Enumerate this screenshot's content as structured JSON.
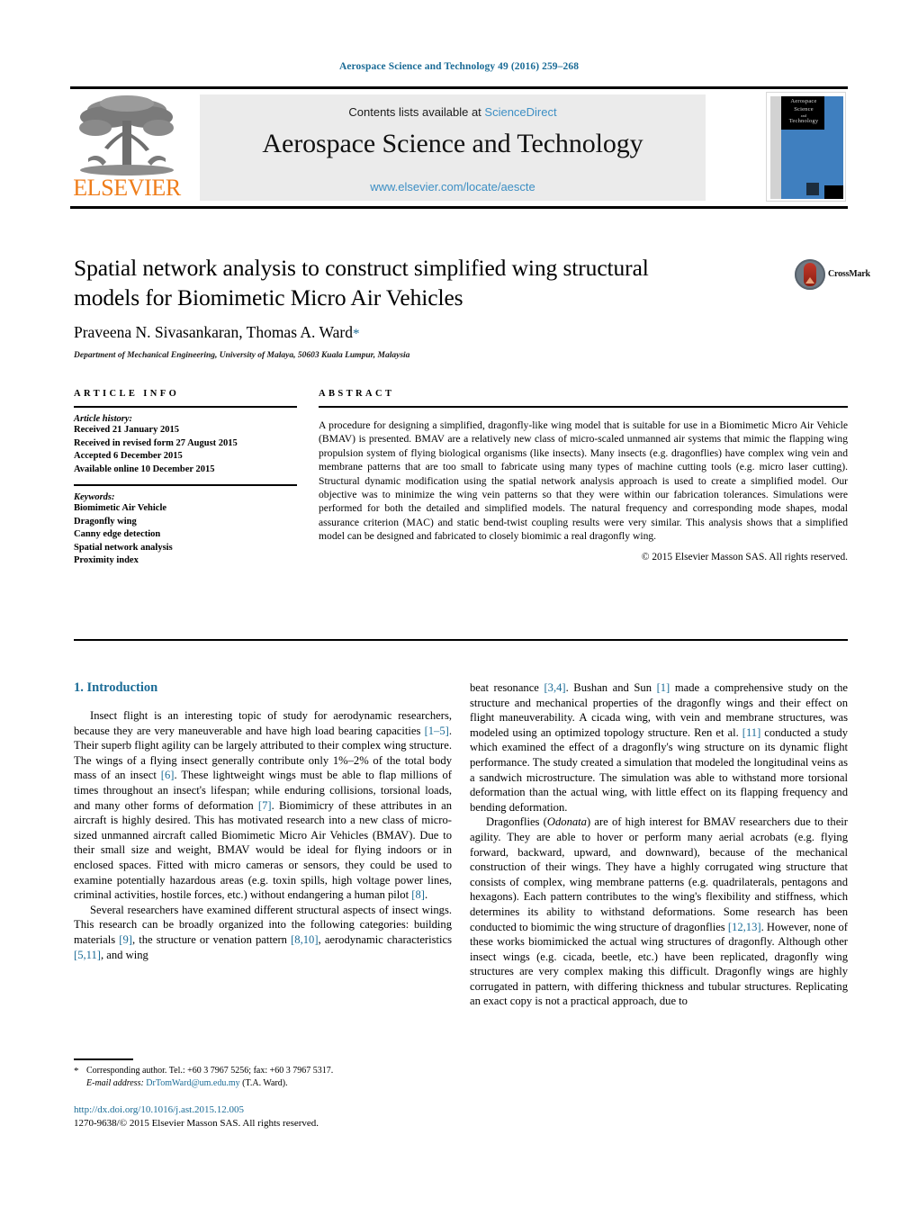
{
  "running_head": "Aerospace Science and Technology 49 (2016) 259–268",
  "masthead": {
    "contents_prefix": "Contents lists available at ",
    "sciencedirect": "ScienceDirect",
    "journal_name": "Aerospace Science and Technology",
    "url": "www.elsevier.com/locate/aescte",
    "publisher": "ELSEVIER",
    "cover_line1": "Aerospace",
    "cover_line2": "Science",
    "cover_line3": "and",
    "cover_line4": "Technology"
  },
  "article": {
    "title": "Spatial network analysis to construct simplified wing structural models for Biomimetic Micro Air Vehicles",
    "authors": "Praveena N. Sivasankaran, Thomas A. Ward",
    "corresponding_marker": "*",
    "affiliation": "Department of Mechanical Engineering, University of Malaya, 50603 Kuala Lumpur, Malaysia",
    "crossmark_label": "CrossMark"
  },
  "article_info": {
    "heading": "ARTICLE INFO",
    "history_label": "Article history:",
    "history": [
      "Received 21 January 2015",
      "Received in revised form 27 August 2015",
      "Accepted 6 December 2015",
      "Available online 10 December 2015"
    ],
    "keywords_label": "Keywords:",
    "keywords": [
      "Biomimetic Air Vehicle",
      "Dragonfly wing",
      "Canny edge detection",
      "Spatial network analysis",
      "Proximity index"
    ]
  },
  "abstract": {
    "heading": "ABSTRACT",
    "text": "A procedure for designing a simplified, dragonfly-like wing model that is suitable for use in a Biomimetic Micro Air Vehicle (BMAV) is presented. BMAV are a relatively new class of micro-scaled unmanned air systems that mimic the flapping wing propulsion system of flying biological organisms (like insects). Many insects (e.g. dragonflies) have complex wing vein and membrane patterns that are too small to fabricate using many types of machine cutting tools (e.g. micro laser cutting). Structural dynamic modification using the spatial network analysis approach is used to create a simplified model. Our objective was to minimize the wing vein patterns so that they were within our fabrication tolerances. Simulations were performed for both the detailed and simplified models. The natural frequency and corresponding mode shapes, modal assurance criterion (MAC) and static bend-twist coupling results were very similar. This analysis shows that a simplified model can be designed and fabricated to closely biomimic a real dragonfly wing.",
    "copyright": "© 2015 Elsevier Masson SAS. All rights reserved."
  },
  "body": {
    "section_heading": "1. Introduction",
    "left_paragraphs": [
      "Insect flight is an interesting topic of study for aerodynamic researchers, because they are very maneuverable and have high load bearing capacities [1–5]. Their superb flight agility can be largely attributed to their complex wing structure. The wings of a flying insect generally contribute only 1%–2% of the total body mass of an insect [6]. These lightweight wings must be able to flap millions of times throughout an insect's lifespan; while enduring collisions, torsional loads, and many other forms of deformation [7]. Biomimicry of these attributes in an aircraft is highly desired. This has motivated research into a new class of micro-sized unmanned aircraft called Biomimetic Micro Air Vehicles (BMAV). Due to their small size and weight, BMAV would be ideal for flying indoors or in enclosed spaces. Fitted with micro cameras or sensors, they could be used to examine potentially hazardous areas (e.g. toxin spills, high voltage power lines, criminal activities, hostile forces, etc.) without endangering a human pilot [8].",
      "Several researchers have examined different structural aspects of insect wings. This research can be broadly organized into the following categories: building materials [9], the structure or venation pattern [8,10], aerodynamic characteristics [5,11], and wing"
    ],
    "right_paragraphs": [
      "beat resonance [3,4]. Bushan and Sun [1] made a comprehensive study on the structure and mechanical properties of the dragonfly wings and their effect on flight maneuverability. A cicada wing, with vein and membrane structures, was modeled using an optimized topology structure. Ren et al. [11] conducted a study which examined the effect of a dragonfly's wing structure on its dynamic flight performance. The study created a simulation that modeled the longitudinal veins as a sandwich microstructure. The simulation was able to withstand more torsional deformation than the actual wing, with little effect on its flapping frequency and bending deformation.",
      "Dragonflies (Odonata) are of high interest for BMAV researchers due to their agility. They are able to hover or perform many aerial acrobats (e.g. flying forward, backward, upward, and downward), because of the mechanical construction of their wings. They have a highly corrugated wing structure that consists of complex, wing membrane patterns (e.g. quadrilaterals, pentagons and hexagons). Each pattern contributes to the wing's flexibility and stiffness, which determines its ability to withstand deformations. Some research has been conducted to biomimic the wing structure of dragonflies [12,13]. However, none of these works biomimicked the actual wing structures of dragonfly. Although other insect wings (e.g. cicada, beetle, etc.) have been replicated, dragonfly wing structures are very complex making this difficult. Dragonfly wings are highly corrugated in pattern, with differing thickness and tubular structures. Replicating an exact copy is not a practical approach, due to"
    ]
  },
  "footnote": {
    "star": "*",
    "corresponding": "Corresponding author. Tel.: +60 3 7967 5256; fax: +60 3 7967 5317.",
    "email_label": "E-mail address:",
    "email": "DrTomWard@um.edu.my",
    "email_suffix": "(T.A. Ward)."
  },
  "footer": {
    "doi": "http://dx.doi.org/10.1016/j.ast.2015.12.005",
    "issn_line": "1270-9638/© 2015 Elsevier Masson SAS. All rights reserved."
  },
  "colors": {
    "link_blue": "#1a6b96",
    "sciencedirect_blue": "#3d8fc4",
    "elsevier_orange": "#ef7d1a",
    "cover_blue": "#3f7fbf"
  }
}
